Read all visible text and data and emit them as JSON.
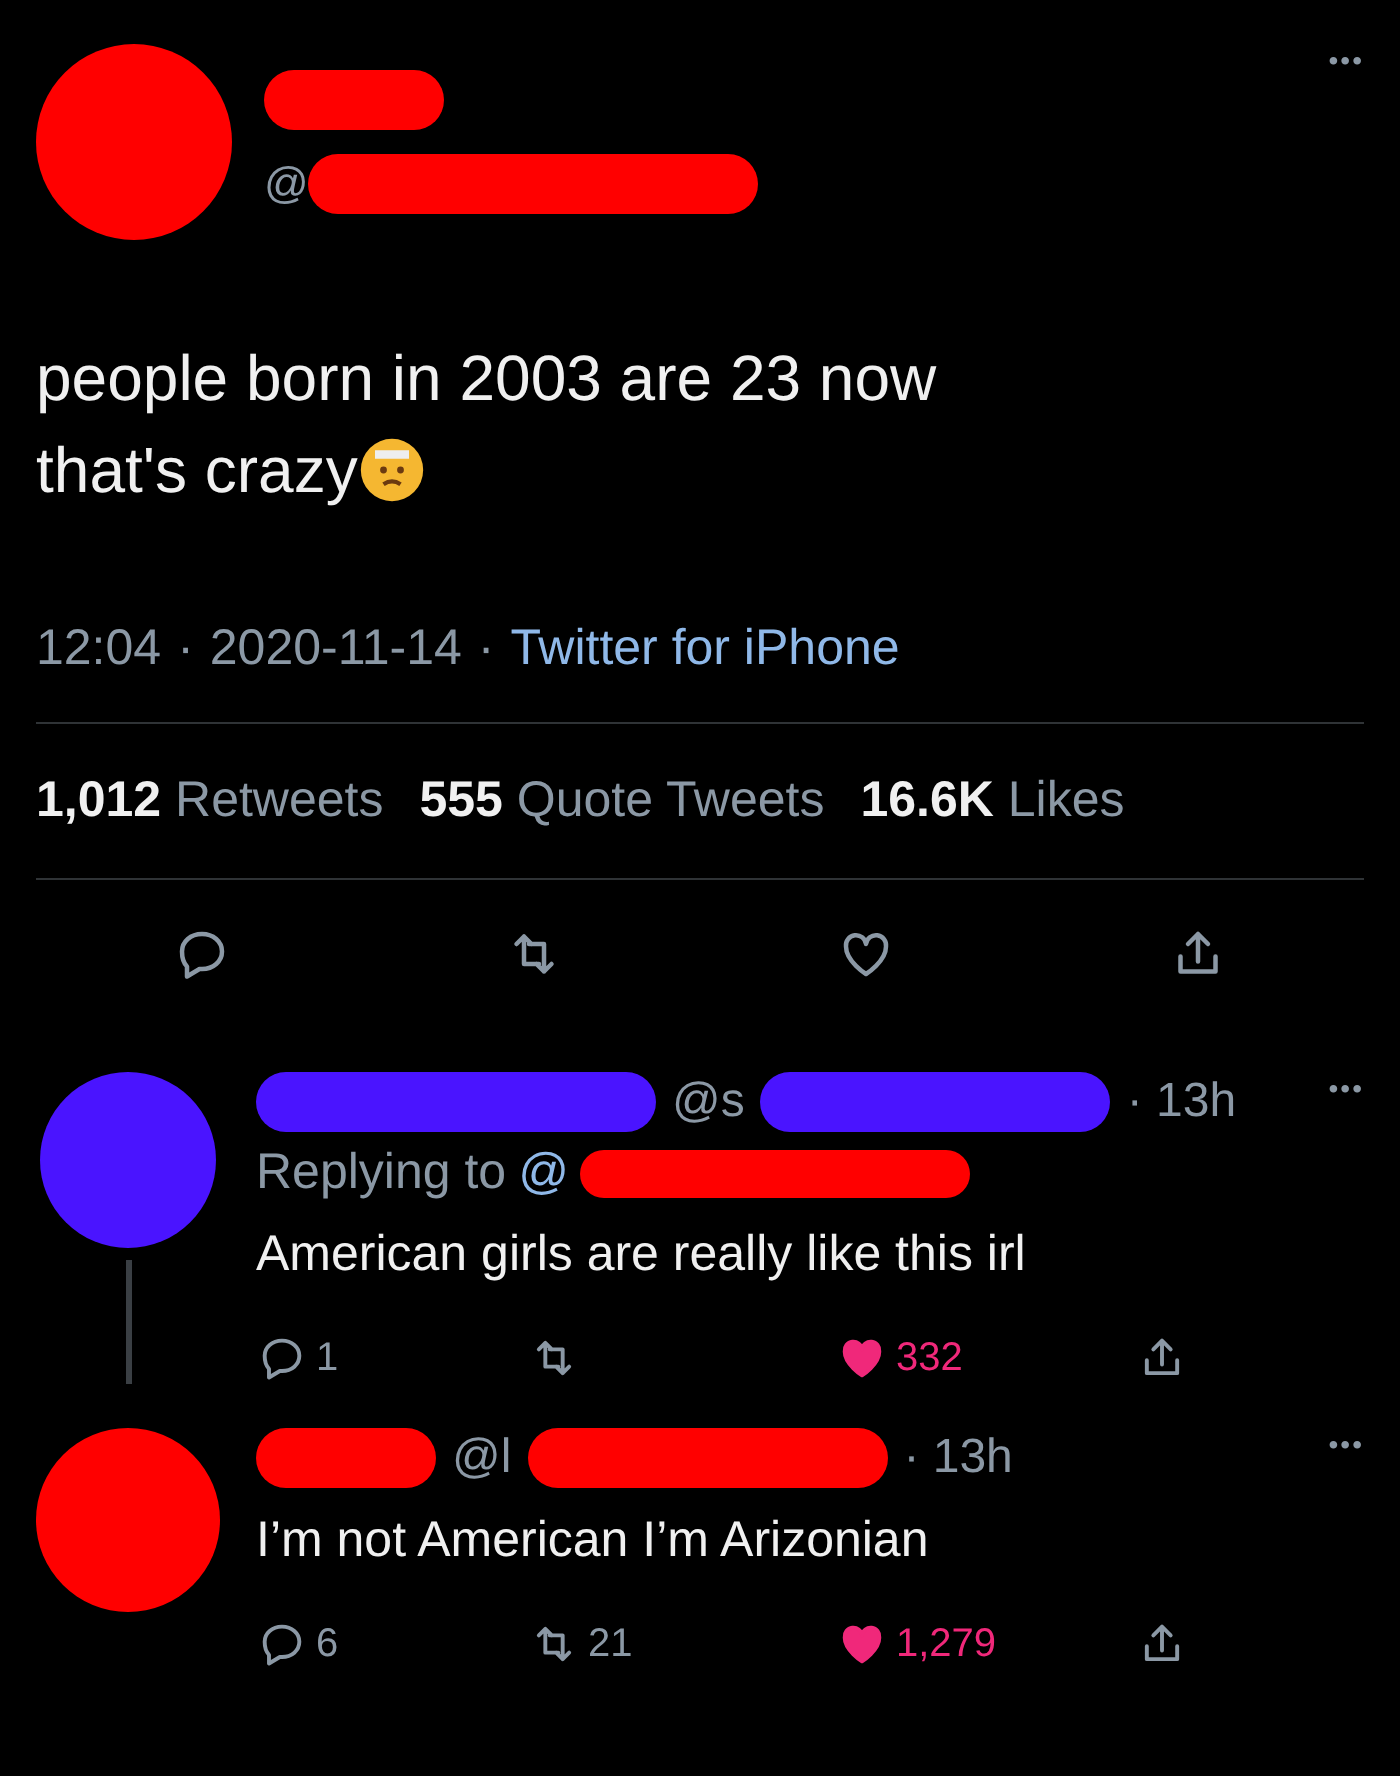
{
  "tweet": {
    "handle": "@",
    "text_lines": [
      "people born in 2003 are 23 now",
      "that's crazy"
    ],
    "time": "12:04",
    "separator": "·",
    "date": "2020-11-14",
    "source": "Twitter for iPhone",
    "stats": [
      {
        "count": "1,012",
        "label": "Retweets"
      },
      {
        "count": "555",
        "label": "Quote Tweets"
      },
      {
        "count": "16.6K",
        "label": "Likes"
      }
    ],
    "more": "•••"
  },
  "replies": [
    {
      "color": "#4a14ff",
      "handle": "@s",
      "time": "· 13h",
      "replying_label": "Replying to",
      "replying_handle": "@",
      "text": "American girls are really like this irl",
      "reply_count": "1",
      "like_count": "332",
      "liked": true,
      "thread_line": true,
      "more": "•••"
    },
    {
      "color": "#ff0000",
      "handle": "@l",
      "time": "· 13h",
      "text": "I’m not American I’m Arizonian",
      "reply_count": "6",
      "retweet_count": "21",
      "like_count": "1,279",
      "liked": true,
      "thread_line": false,
      "more": "•••"
    }
  ]
}
